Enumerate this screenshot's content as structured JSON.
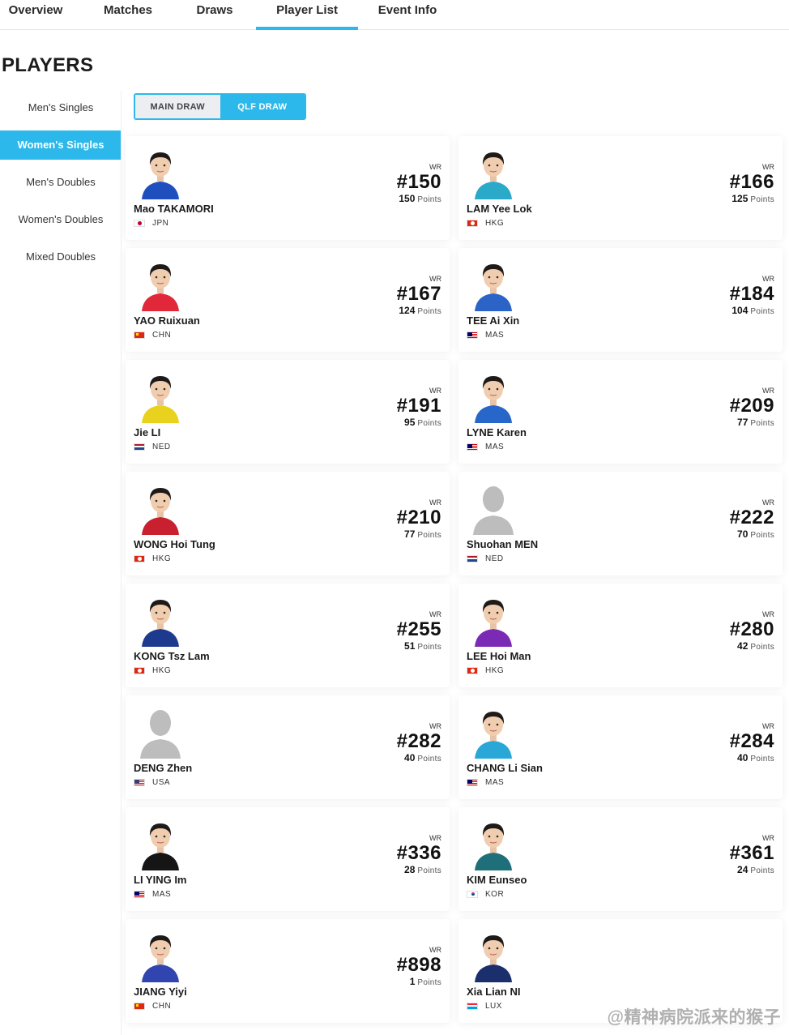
{
  "topnav": {
    "tabs": [
      {
        "label": "Overview"
      },
      {
        "label": "Matches"
      },
      {
        "label": "Draws"
      },
      {
        "label": "Player List"
      },
      {
        "label": "Event Info"
      }
    ],
    "active_index": 3
  },
  "heading": "PLAYERS",
  "sidebar": {
    "items": [
      {
        "label": "Men's Singles"
      },
      {
        "label": "Women's Singles"
      },
      {
        "label": "Men's Doubles"
      },
      {
        "label": "Women's Doubles"
      },
      {
        "label": "Mixed Doubles"
      }
    ],
    "active_index": 1
  },
  "draw_toggle": {
    "main_label": "MAIN DRAW",
    "qlf_label": "QLF DRAW",
    "active": "qlf"
  },
  "wr_label": "WR",
  "points_label": "Points",
  "colors": {
    "accent": "#2cb8ea",
    "text": "#1b1b1b"
  },
  "players": [
    {
      "name": "Mao TAKAMORI",
      "country": "JPN",
      "rank": "#150",
      "points": "150",
      "shirt": "#1f4fbf",
      "photo": true
    },
    {
      "name": "LAM Yee Lok",
      "country": "HKG",
      "rank": "#166",
      "points": "125",
      "shirt": "#2aa9c9",
      "photo": true
    },
    {
      "name": "YAO Ruixuan",
      "country": "CHN",
      "rank": "#167",
      "points": "124",
      "shirt": "#e0283a",
      "photo": true
    },
    {
      "name": "TEE Ai Xin",
      "country": "MAS",
      "rank": "#184",
      "points": "104",
      "shirt": "#2c63c7",
      "photo": true
    },
    {
      "name": "Jie LI",
      "country": "NED",
      "rank": "#191",
      "points": "95",
      "shirt": "#e9d21e",
      "photo": true
    },
    {
      "name": "LYNE Karen",
      "country": "MAS",
      "rank": "#209",
      "points": "77",
      "shirt": "#2767c9",
      "photo": true
    },
    {
      "name": "WONG Hoi Tung",
      "country": "HKG",
      "rank": "#210",
      "points": "77",
      "shirt": "#c8202e",
      "photo": true
    },
    {
      "name": "Shuohan MEN",
      "country": "NED",
      "rank": "#222",
      "points": "70",
      "shirt": "#b5b5b5",
      "photo": false
    },
    {
      "name": "KONG Tsz Lam",
      "country": "HKG",
      "rank": "#255",
      "points": "51",
      "shirt": "#1d3a8f",
      "photo": true
    },
    {
      "name": "LEE Hoi Man",
      "country": "HKG",
      "rank": "#280",
      "points": "42",
      "shirt": "#7b2ab6",
      "photo": true
    },
    {
      "name": "DENG Zhen",
      "country": "USA",
      "rank": "#282",
      "points": "40",
      "shirt": "#b5b5b5",
      "photo": false
    },
    {
      "name": "CHANG Li Sian",
      "country": "MAS",
      "rank": "#284",
      "points": "40",
      "shirt": "#29a8d8",
      "photo": true
    },
    {
      "name": "LI YING Im",
      "country": "MAS",
      "rank": "#336",
      "points": "28",
      "shirt": "#151515",
      "photo": true
    },
    {
      "name": "KIM Eunseo",
      "country": "KOR",
      "rank": "#361",
      "points": "24",
      "shirt": "#1f6f7a",
      "photo": true
    },
    {
      "name": "JIANG Yiyi",
      "country": "CHN",
      "rank": "#898",
      "points": "1",
      "shirt": "#3045b0",
      "photo": true
    },
    {
      "name": "Xia Lian NI",
      "country": "LUX",
      "rank": "",
      "points": "",
      "shirt": "#1a2f6b",
      "photo": true
    }
  ],
  "watermark": "@精神病院派来的猴子"
}
